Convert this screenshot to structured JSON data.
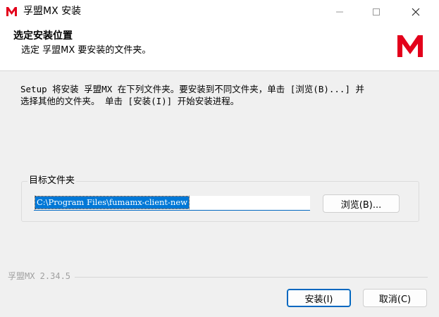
{
  "window": {
    "title": "孚盟MX 安装",
    "minimize_icon": "minimize-icon",
    "maximize_icon": "maximize-icon",
    "close_icon": "close-icon"
  },
  "header": {
    "title": "选定安装位置",
    "subtitle": "选定 孚盟MX 要安装的文件夹。",
    "logo_letter": "M",
    "brand_color": "#e3001b"
  },
  "body": {
    "description": "Setup 将安装 孚盟MX 在下列文件夹。要安装到不同文件夹，单击 [浏览(B)...] 并\n选择其他的文件夹。 单击 [安装(I)] 开始安装进程。"
  },
  "destination": {
    "group_label": "目标文件夹",
    "path_value": "C:\\Program Files\\fumamx-client-new",
    "browse_label": "浏览(B)..."
  },
  "footer": {
    "version": "孚盟MX 2.34.5",
    "install_label": "安装(I)",
    "cancel_label": "取消(C)"
  }
}
